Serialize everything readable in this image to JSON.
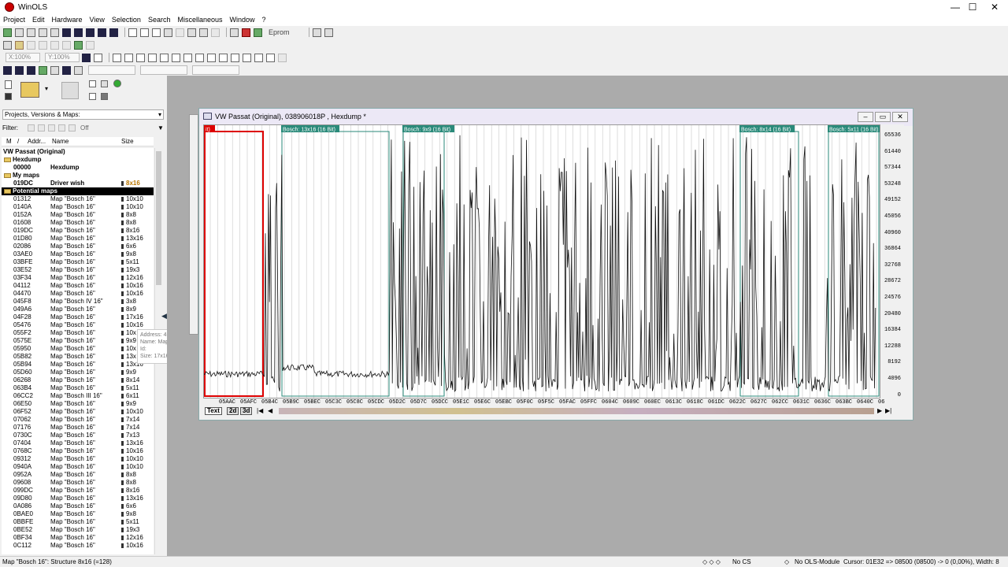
{
  "app": {
    "title": "WinOLS",
    "window_controls": [
      "—",
      "☐",
      "✕"
    ]
  },
  "menu": [
    "Project",
    "Edit",
    "Hardware",
    "View",
    "Selection",
    "Search",
    "Miscellaneous",
    "Window",
    "?"
  ],
  "toolbar": {
    "eprom_label": "Eprom",
    "zoom_x": "X:100%",
    "zoom_y": "Y:100%"
  },
  "left_panel": {
    "combo_label": "Projects, Versions & Maps:",
    "filter_label": "Filter:",
    "filter_state": "Off",
    "headers": [
      "M",
      "/",
      "Addr...",
      "Name",
      "Size"
    ],
    "tree": [
      {
        "kind": "root",
        "label": "VW Passat (Original)"
      },
      {
        "kind": "group",
        "label": "Hexdump"
      },
      {
        "kind": "item",
        "addr": "00000",
        "name": "Hexdump",
        "size": ""
      },
      {
        "kind": "group",
        "label": "My maps"
      },
      {
        "kind": "item",
        "addr": "019DC",
        "name": "Driver wish",
        "size": "8x16"
      },
      {
        "kind": "group_sel",
        "label": "Potential maps"
      }
    ],
    "maps": [
      [
        "01312",
        "Map \"Bosch 16\"",
        "10x10"
      ],
      [
        "0140A",
        "Map \"Bosch 16\"",
        "10x10"
      ],
      [
        "0152A",
        "Map \"Bosch 16\"",
        "8x8"
      ],
      [
        "01608",
        "Map \"Bosch 16\"",
        "8x8"
      ],
      [
        "019DC",
        "Map \"Bosch 16\"",
        "8x16"
      ],
      [
        "01D80",
        "Map \"Bosch 16\"",
        "13x16"
      ],
      [
        "02086",
        "Map \"Bosch 16\"",
        "6x6"
      ],
      [
        "03AE0",
        "Map \"Bosch 16\"",
        "9x8"
      ],
      [
        "03BFE",
        "Map \"Bosch 16\"",
        "5x11"
      ],
      [
        "03E52",
        "Map \"Bosch 16\"",
        "19x3"
      ],
      [
        "03F34",
        "Map \"Bosch 16\"",
        "12x16"
      ],
      [
        "04112",
        "Map \"Bosch 16\"",
        "10x16"
      ],
      [
        "04470",
        "Map \"Bosch 16\"",
        "10x16"
      ],
      [
        "045F8",
        "Map \"Bosch IV 16\"",
        "3x8"
      ],
      [
        "049A6",
        "Map \"Bosch 16\"",
        "8x9"
      ],
      [
        "04F28",
        "Map \"Bosch 16\"",
        "17x16"
      ],
      [
        "05476",
        "Map \"Bosch 16\"",
        "10x16"
      ],
      [
        "055F2",
        "Map \"Bosch 16\"",
        "10x"
      ],
      [
        "0575E",
        "Map \"Bosch 16\"",
        "9x9"
      ],
      [
        "05950",
        "Map \"Bosch 16\"",
        "10x"
      ],
      [
        "05B82",
        "Map \"Bosch 16\"",
        "13x"
      ],
      [
        "05B94",
        "Map \"Bosch 16\"",
        "13x16"
      ],
      [
        "05D60",
        "Map \"Bosch 16\"",
        "9x9"
      ],
      [
        "06268",
        "Map \"Bosch 16\"",
        "8x14"
      ],
      [
        "063B4",
        "Map \"Bosch 16\"",
        "5x11"
      ],
      [
        "06CC2",
        "Map \"Bosch III 16\"",
        "6x11"
      ],
      [
        "06E50",
        "Map \"Bosch 16\"",
        "9x9"
      ],
      [
        "06F52",
        "Map \"Bosch 16\"",
        "10x10"
      ],
      [
        "07062",
        "Map \"Bosch 16\"",
        "7x14"
      ],
      [
        "07176",
        "Map \"Bosch 16\"",
        "7x14"
      ],
      [
        "0730C",
        "Map \"Bosch 16\"",
        "7x13"
      ],
      [
        "07404",
        "Map \"Bosch 16\"",
        "13x16"
      ],
      [
        "0768C",
        "Map \"Bosch 16\"",
        "10x16"
      ],
      [
        "09312",
        "Map \"Bosch 16\"",
        "10x10"
      ],
      [
        "0940A",
        "Map \"Bosch 16\"",
        "10x10"
      ],
      [
        "0952A",
        "Map \"Bosch 16\"",
        "8x8"
      ],
      [
        "09608",
        "Map \"Bosch 16\"",
        "8x8"
      ],
      [
        "099DC",
        "Map \"Bosch 16\"",
        "8x16"
      ],
      [
        "09D80",
        "Map \"Bosch 16\"",
        "13x16"
      ],
      [
        "0A086",
        "Map \"Bosch 16\"",
        "6x6"
      ],
      [
        "0BAE0",
        "Map \"Bosch 16\"",
        "9x8"
      ],
      [
        "0BBFE",
        "Map \"Bosch 16\"",
        "5x11"
      ],
      [
        "0BE52",
        "Map \"Bosch 16\"",
        "19x3"
      ],
      [
        "0BF34",
        "Map \"Bosch 16\"",
        "12x16"
      ],
      [
        "0C112",
        "Map \"Bosch 16\"",
        "10x16"
      ]
    ]
  },
  "tooltip": {
    "address": "Address: 4F28",
    "name": "Name: Map \"Bosch 16\"",
    "id": "Id:",
    "size": "Size: 17x16"
  },
  "hexwin": {
    "title": "VW Passat (Original), 038906018P , Hexdump *",
    "map_labels": [
      "it)",
      "Bosch: 13x16 (16 Bit)",
      "Bosch: 9x9 (16 Bit)",
      "Bosch: 8x14 (16 Bit)",
      "Bosch: 5x11 (16 Bit)"
    ],
    "y_ticks": [
      "65536",
      "61440",
      "57344",
      "53248",
      "49152",
      "45056",
      "40960",
      "36864",
      "32768",
      "28672",
      "24576",
      "20480",
      "16384",
      "12288",
      "8192",
      "4096",
      "0"
    ],
    "x_ticks": [
      "05AAC",
      "05AFC",
      "05B4C",
      "05B9C",
      "05BEC",
      "05C3C",
      "05C8C",
      "05CDC",
      "05D2C",
      "05D7C",
      "05DCC",
      "05E1C",
      "05E6C",
      "05EBC",
      "05F0C",
      "05F5C",
      "05FAC",
      "05FFC",
      "0604C",
      "0609C",
      "060EC",
      "0613C",
      "0618C",
      "061DC",
      "0622C",
      "0627C",
      "062CC",
      "0631C",
      "0636C",
      "063BC",
      "0640C",
      "06"
    ],
    "tabs": [
      "Text",
      "2d",
      "3d"
    ]
  },
  "status": {
    "left": "Map \"Bosch 16\": Structure 8x16 (=128)",
    "cs": "No CS",
    "module": "No OLS-Module",
    "cursor": "Cursor: 01E32 => 08500 (08500) -> 0 (0,00%), Width: 8"
  }
}
